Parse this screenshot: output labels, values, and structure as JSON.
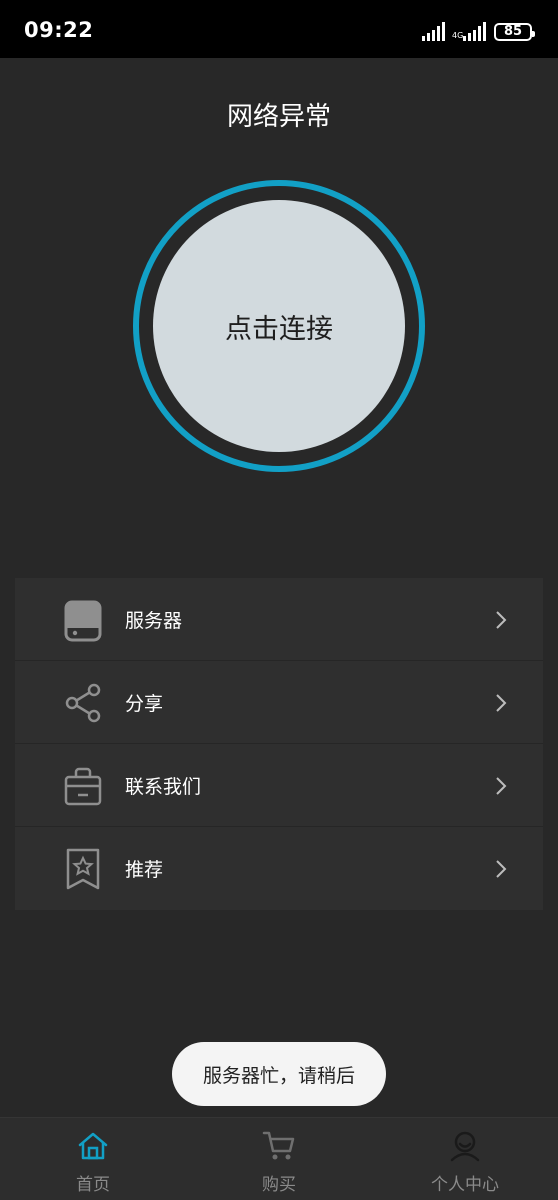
{
  "status_bar": {
    "time": "09:22",
    "battery": "85"
  },
  "header": {
    "title": "网络异常"
  },
  "connect": {
    "label": "点击连接",
    "ring_color": "#12a0c6"
  },
  "menu": {
    "items": [
      {
        "label": "服务器",
        "icon": "server-icon"
      },
      {
        "label": "分享",
        "icon": "share-icon"
      },
      {
        "label": "联系我们",
        "icon": "contact-bag-icon"
      },
      {
        "label": "推荐",
        "icon": "bookmark-star-icon"
      }
    ]
  },
  "toast": {
    "message": "服务器忙，请稍后"
  },
  "bottom_nav": {
    "items": [
      {
        "label": "首页",
        "icon": "home-icon",
        "active": true
      },
      {
        "label": "购买",
        "icon": "cart-icon",
        "active": false
      },
      {
        "label": "个人中心",
        "icon": "user-icon",
        "active": false
      }
    ],
    "active_color": "#12a0c6"
  }
}
